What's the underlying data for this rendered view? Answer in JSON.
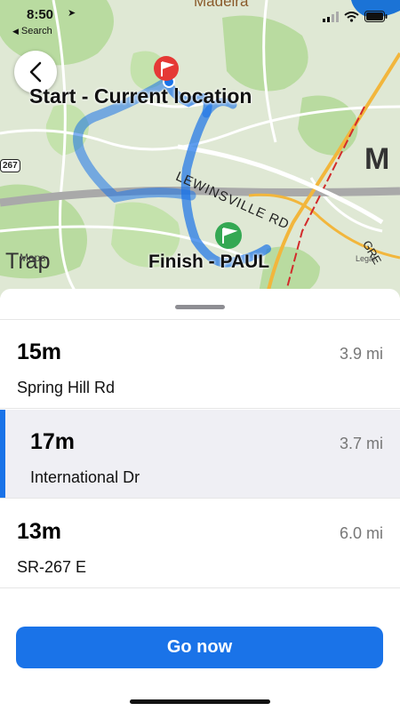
{
  "status_bar": {
    "time": "8:50",
    "back_app_label": "Search"
  },
  "map": {
    "start_label": "Start - Current location",
    "finish_label": "Finish - PAUL",
    "place_madeira": "Madeira",
    "place_trap": "Trap",
    "place_m": "M",
    "road_lewinsville": "LEWINSVILLE RD",
    "road_gre": "GRE",
    "shield_267": "267",
    "attribution_maps": "Maps",
    "attribution_legal": "Legal",
    "colors": {
      "route": "#1a73e8",
      "park": "#b9dba0",
      "water": "#1b73d6",
      "highway": "#f2b63c"
    }
  },
  "routes": [
    {
      "duration": "15m",
      "distance": "3.9 mi",
      "via": "Spring Hill Rd",
      "selected": false
    },
    {
      "duration": "17m",
      "distance": "3.7 mi",
      "via": "International Dr",
      "selected": true
    },
    {
      "duration": "13m",
      "distance": "6.0 mi",
      "via": "SR-267 E",
      "selected": false
    }
  ],
  "go_button": {
    "label": "Go now"
  }
}
